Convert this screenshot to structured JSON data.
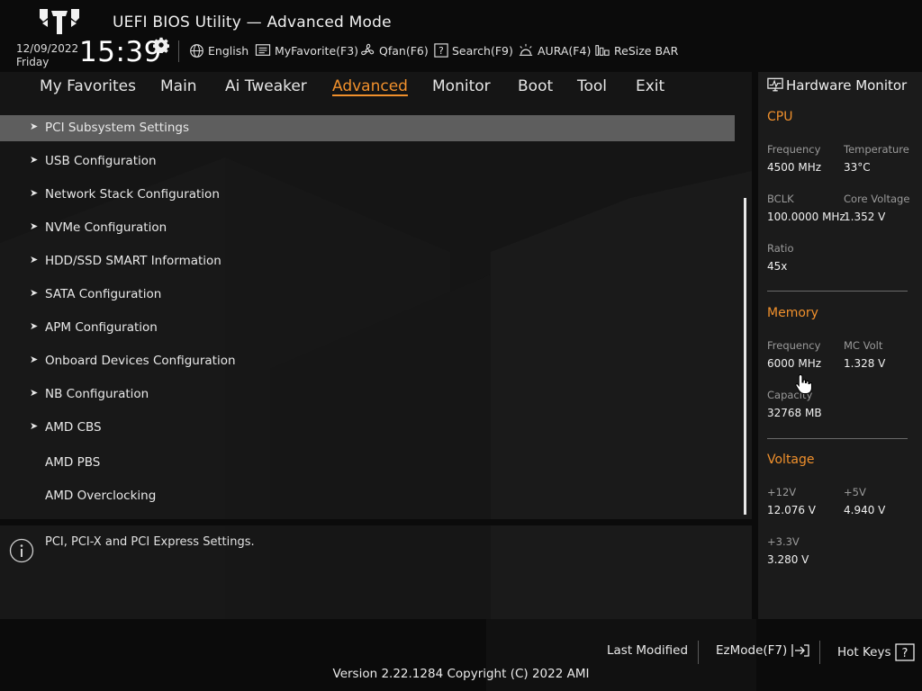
{
  "header": {
    "title": "UEFI BIOS Utility — Advanced Mode",
    "date": "12/09/2022",
    "day": "Friday",
    "time": "15:39",
    "tools": [
      {
        "label": "English",
        "icon": "globe-icon"
      },
      {
        "label": "MyFavorite(F3)",
        "icon": "favorite-list-icon"
      },
      {
        "label": "Qfan(F6)",
        "icon": "fan-icon"
      },
      {
        "label": "Search(F9)",
        "icon": "search-question-icon"
      },
      {
        "label": "AURA(F4)",
        "icon": "aura-light-icon"
      },
      {
        "label": "ReSize BAR",
        "icon": "resize-bar-icon"
      }
    ]
  },
  "nav": {
    "tabs": [
      {
        "label": "My Favorites"
      },
      {
        "label": "Main"
      },
      {
        "label": "Ai Tweaker"
      },
      {
        "label": "Advanced",
        "active": true
      },
      {
        "label": "Monitor"
      },
      {
        "label": "Boot"
      },
      {
        "label": "Tool"
      },
      {
        "label": "Exit"
      }
    ]
  },
  "menu": {
    "items": [
      {
        "label": "PCI Subsystem Settings",
        "submenu": true,
        "selected": true
      },
      {
        "label": "USB Configuration",
        "submenu": true
      },
      {
        "label": "Network Stack Configuration",
        "submenu": true
      },
      {
        "label": "NVMe Configuration",
        "submenu": true
      },
      {
        "label": "HDD/SSD SMART Information",
        "submenu": true
      },
      {
        "label": "SATA Configuration",
        "submenu": true
      },
      {
        "label": "APM Configuration",
        "submenu": true
      },
      {
        "label": "Onboard Devices Configuration",
        "submenu": true
      },
      {
        "label": "NB Configuration",
        "submenu": true
      },
      {
        "label": "AMD CBS",
        "submenu": true
      },
      {
        "label": "AMD PBS",
        "submenu": false
      },
      {
        "label": "AMD Overclocking",
        "submenu": false
      }
    ],
    "arrow_glyph": "➤"
  },
  "description": "PCI, PCI-X and PCI Express Settings.",
  "hardware_monitor": {
    "title": "Hardware Monitor",
    "cpu": {
      "heading": "CPU",
      "frequency_label": "Frequency",
      "frequency": "4500 MHz",
      "temperature_label": "Temperature",
      "temperature": "33°C",
      "bclk_label": "BCLK",
      "bclk": "100.0000 MHz",
      "core_voltage_label": "Core Voltage",
      "core_voltage": "1.352 V",
      "ratio_label": "Ratio",
      "ratio": "45x"
    },
    "memory": {
      "heading": "Memory",
      "frequency_label": "Frequency",
      "frequency": "6000 MHz",
      "mc_volt_label": "MC Volt",
      "mc_volt": "1.328 V",
      "capacity_label": "Capacity",
      "capacity": "32768 MB"
    },
    "voltage": {
      "heading": "Voltage",
      "v12_label": "+12V",
      "v12": "12.076 V",
      "v5_label": "+5V",
      "v5": "4.940 V",
      "v33_label": "+3.3V",
      "v33": "3.280 V"
    }
  },
  "footer": {
    "last_modified": "Last Modified",
    "ezmode": "EzMode(F7)",
    "hotkeys": "Hot Keys",
    "version": "Version 2.22.1284 Copyright (C) 2022 AMI"
  },
  "colors": {
    "accent": "#f0902c",
    "selected_row": "#5e5e5e",
    "panel": "#151515",
    "background": "#0b0b0b"
  }
}
